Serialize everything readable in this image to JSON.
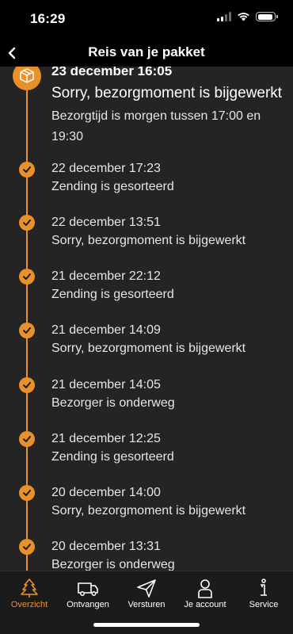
{
  "status_bar": {
    "time": "16:29"
  },
  "nav": {
    "title": "Reis van je pakket"
  },
  "latest_event": {
    "date": "23 december 16:05",
    "title": "Sorry, bezorgmoment is bijgewerkt",
    "detail": "Bezorgtijd is morgen tussen 17:00 en 19:30"
  },
  "events": [
    {
      "date": "22 december 17:23",
      "title": "Zending is gesorteerd"
    },
    {
      "date": "22 december 13:51",
      "title": "Sorry, bezorgmoment is bijgewerkt"
    },
    {
      "date": "21 december 22:12",
      "title": "Zending is gesorteerd"
    },
    {
      "date": "21 december 14:09",
      "title": "Sorry, bezorgmoment is bijgewerkt"
    },
    {
      "date": "21 december 14:05",
      "title": "Bezorger is onderweg"
    },
    {
      "date": "21 december 12:25",
      "title": "Zending is gesorteerd"
    },
    {
      "date": "20 december 14:00",
      "title": "Sorry, bezorgmoment is bijgewerkt"
    },
    {
      "date": "20 december 13:31",
      "title": "Bezorger is onderweg"
    }
  ],
  "tabs": [
    {
      "label": "Overzicht",
      "icon": "tree-icon",
      "active": true
    },
    {
      "label": "Ontvangen",
      "icon": "van-icon",
      "active": false
    },
    {
      "label": "Versturen",
      "icon": "paper-plane-icon",
      "active": false
    },
    {
      "label": "Je account",
      "icon": "person-icon",
      "active": false
    },
    {
      "label": "Service",
      "icon": "info-icon",
      "active": false
    }
  ],
  "colors": {
    "accent": "#e8912a",
    "background": "#242424",
    "header": "#000000"
  }
}
